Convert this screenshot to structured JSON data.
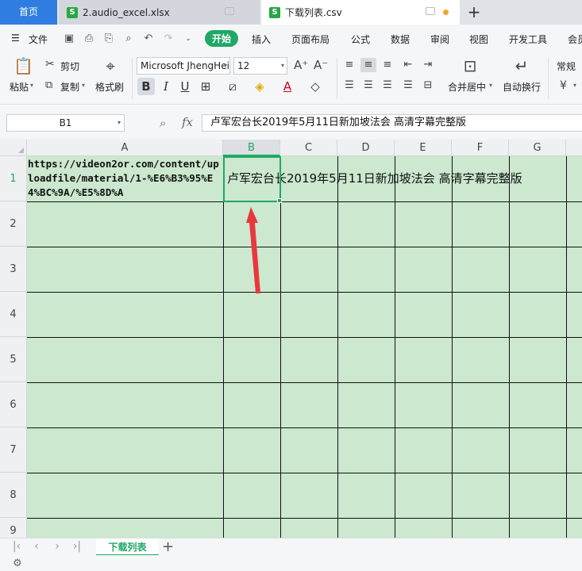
{
  "tabs": {
    "home": "首页",
    "doc1": "2.audio_excel.xlsx",
    "doc2": "下载列表.csv",
    "doc_icon_letter": "S"
  },
  "menu": {
    "file": "文件",
    "items": [
      "开始",
      "插入",
      "页面布局",
      "公式",
      "数据",
      "审阅",
      "视图",
      "开发工具",
      "会员"
    ],
    "active": "开始"
  },
  "ribbon": {
    "paste": "粘贴",
    "cut": "剪切",
    "copy": "复制",
    "format_painter": "格式刷",
    "font_name": "Microsoft JhengHei",
    "font_size": "12",
    "merge_center": "合并居中",
    "wrap_text": "自动换行",
    "number_format": "常规",
    "currency_symbol": "¥"
  },
  "formula_bar": {
    "cell_ref": "B1",
    "fx": "fx",
    "content": "卢军宏台长2019年5月11日新加坡法会 高清字幕完整版"
  },
  "grid": {
    "columns": [
      "A",
      "B",
      "C",
      "D",
      "E",
      "F",
      "G"
    ],
    "rows": [
      "1",
      "2",
      "3",
      "4",
      "5",
      "6",
      "7",
      "8",
      "9"
    ],
    "selected_cell": "B1",
    "cell_a1": "https://videon2or.com/content/uploadfile/material/1-%E6%B3%95%E4%BC%9A/%E5%8D%A",
    "cell_b1": "卢军宏台长2019年5月11日新加坡法会 高清字幕完整版"
  },
  "sheets": {
    "active": "下载列表"
  },
  "colors": {
    "accent_green": "#1fa866",
    "cell_fill": "#cce8cf",
    "home_tab": "#2f7de1",
    "arrow_red": "#e8383d"
  }
}
